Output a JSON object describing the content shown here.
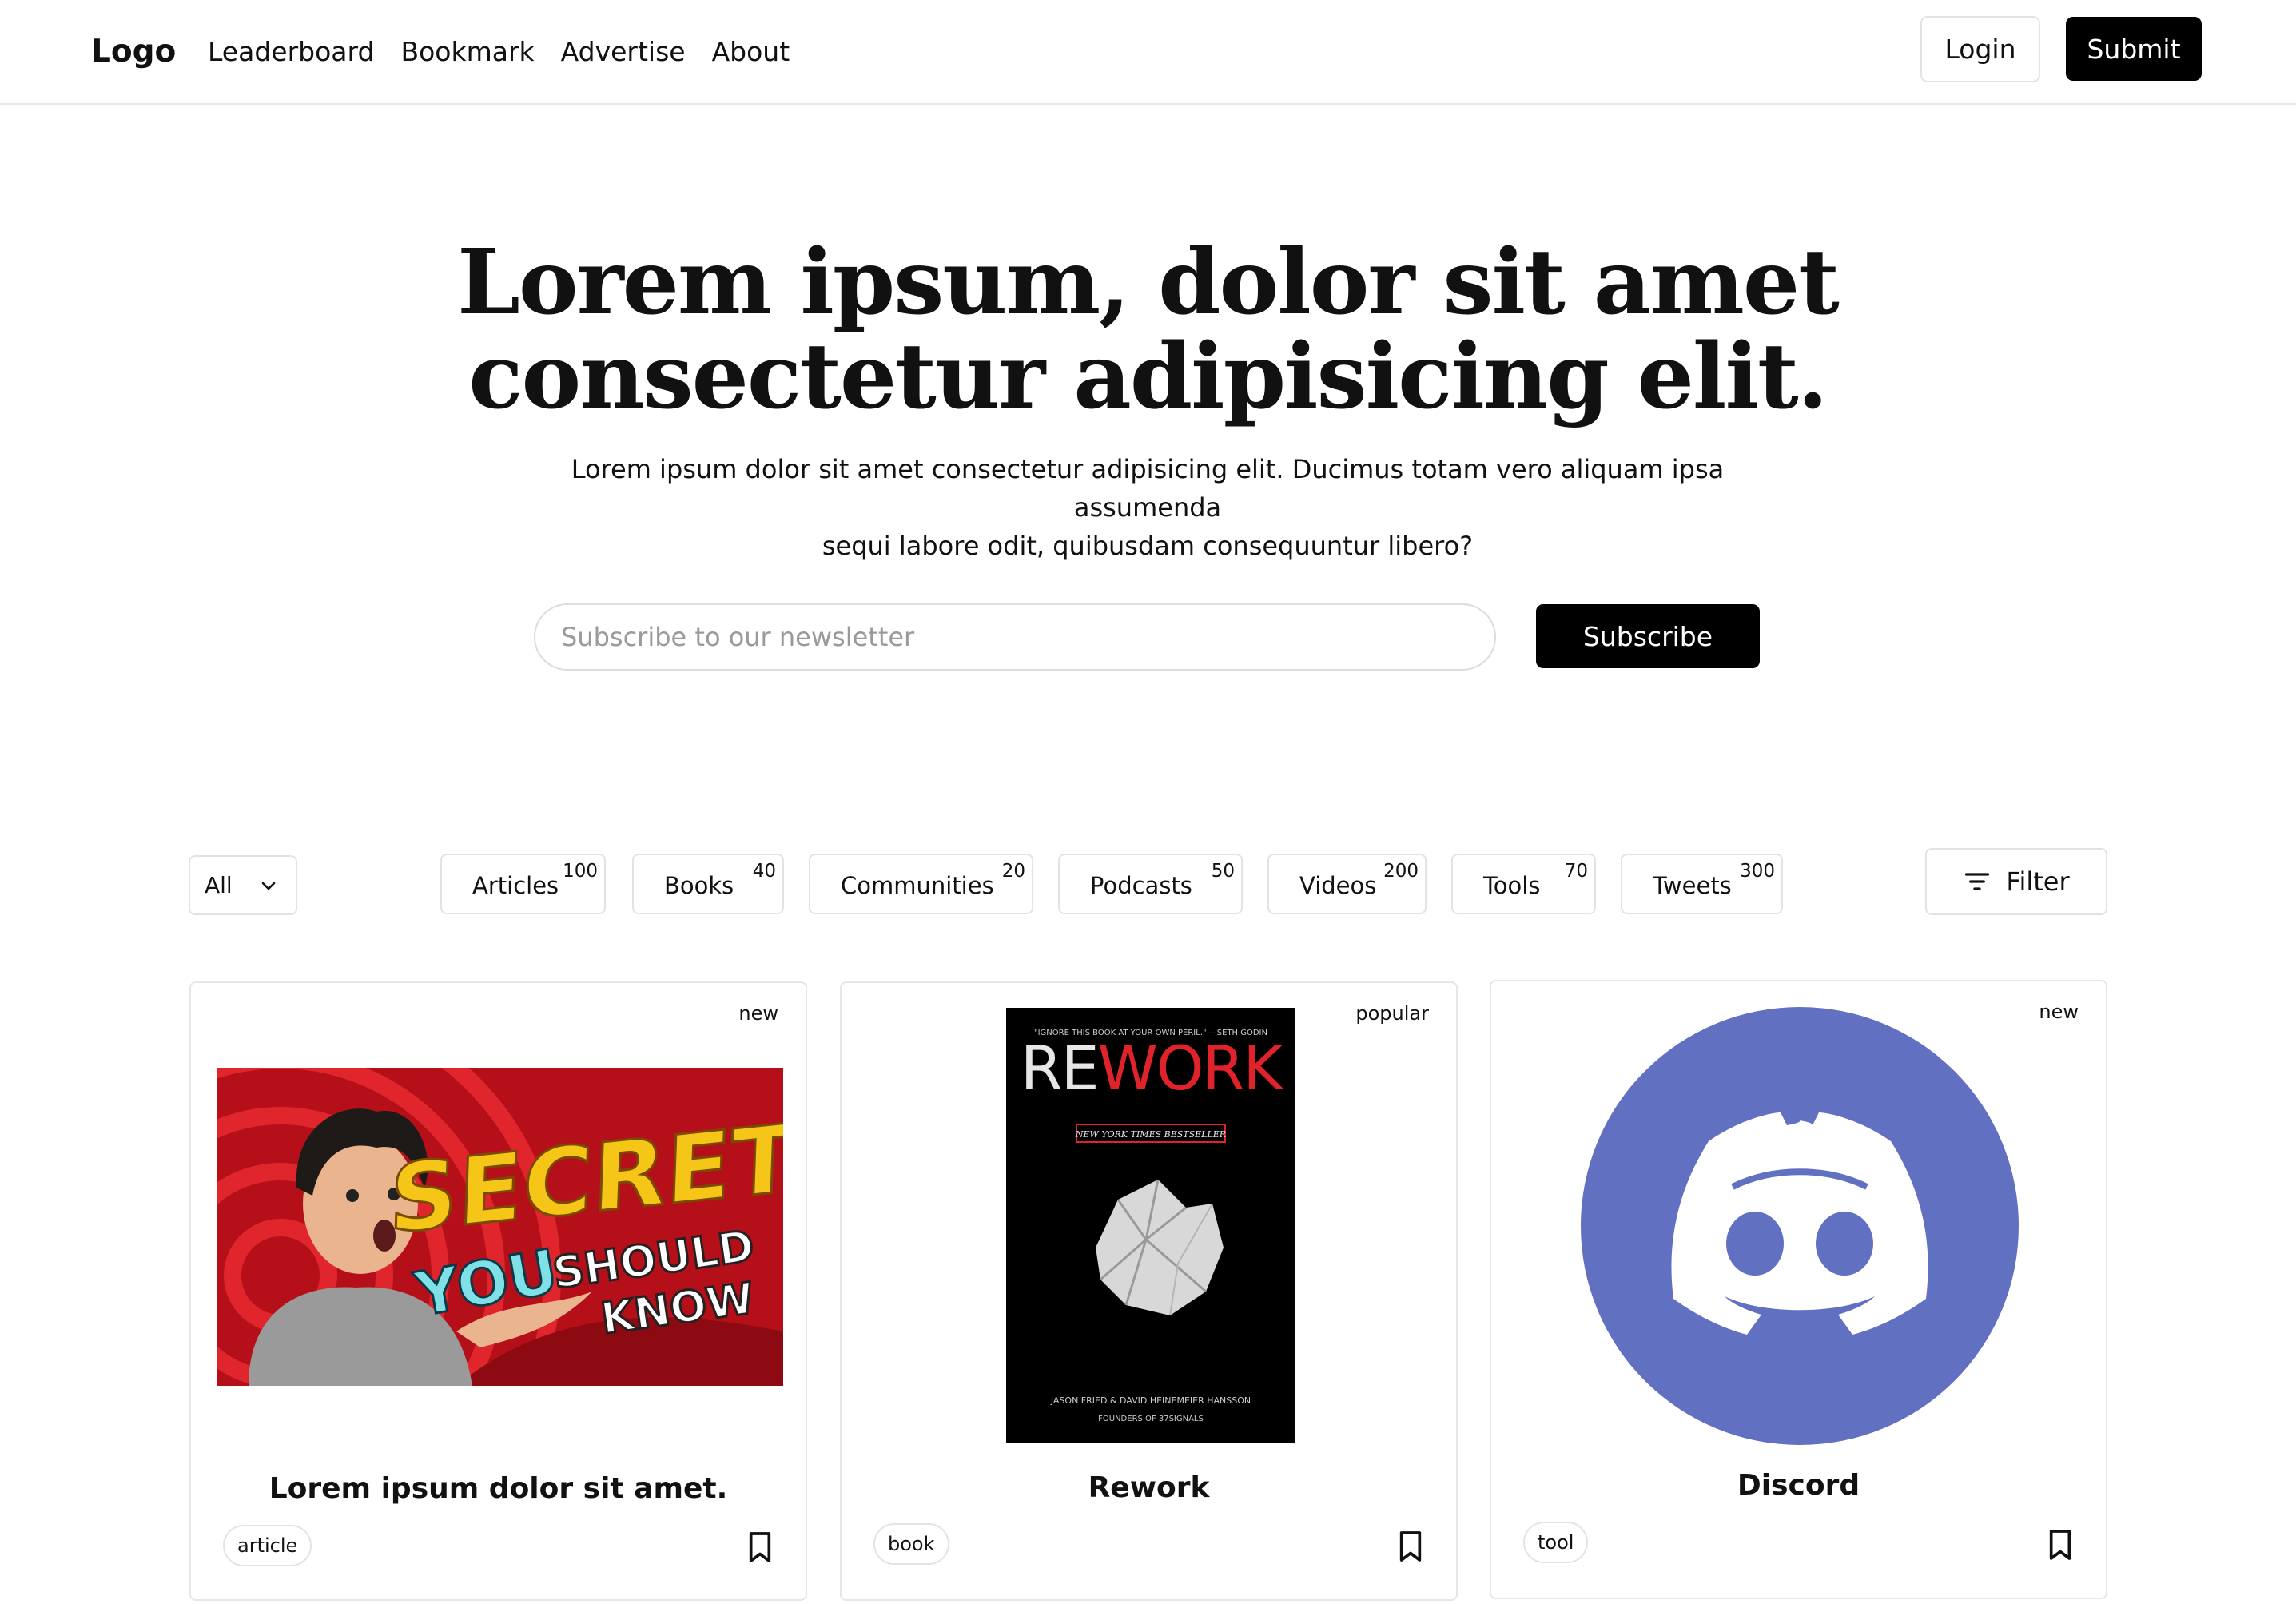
{
  "header": {
    "logo": "Logo",
    "nav": [
      "Leaderboard",
      "Bookmark",
      "Advertise",
      "About"
    ],
    "login_label": "Login",
    "submit_label": "Submit"
  },
  "hero": {
    "title_line1": "Lorem ipsum, dolor sit amet",
    "title_line2": "consectetur adipisicing elit.",
    "subtitle_line1": "Lorem ipsum dolor sit amet consectetur adipisicing elit. Ducimus totam vero aliquam ipsa assumenda",
    "subtitle_line2": "sequi labore odit, quibusdam consequuntur libero?"
  },
  "newsletter": {
    "placeholder": "Subscribe to our newsletter",
    "value": "",
    "button_label": "Subscribe"
  },
  "filters": {
    "select_value": "All",
    "categories": [
      {
        "label": "Articles",
        "count": "100"
      },
      {
        "label": "Books",
        "count": "40"
      },
      {
        "label": "Communities",
        "count": "20"
      },
      {
        "label": "Podcasts",
        "count": "50"
      },
      {
        "label": "Videos",
        "count": "200"
      },
      {
        "label": "Tools",
        "count": "70"
      },
      {
        "label": "Tweets",
        "count": "300"
      }
    ],
    "filter_label": "Filter"
  },
  "cards": [
    {
      "badge": "new",
      "title": "Lorem ipsum dolor sit amet.",
      "tag": "article",
      "image": {
        "word1": "SECRETS",
        "word2": "YOU",
        "word3": "SHOULD",
        "word4": "KNOW"
      }
    },
    {
      "badge": "popular",
      "title": "Rework",
      "tag": "book",
      "image": {
        "quote": "\"IGNORE THIS BOOK AT YOUR OWN PERIL.\" —SETH GODIN",
        "title_re": "RE",
        "title_work": "WORK",
        "bestseller": "NEW YORK TIMES BESTSELLER",
        "authors": "JASON FRIED & DAVID HEINEMEIER HANSSON",
        "founders": "FOUNDERS OF 37SIGNALS"
      }
    },
    {
      "badge": "new",
      "title": "Discord",
      "tag": "tool",
      "image": {
        "icon": "discord-logo"
      }
    }
  ],
  "colors": {
    "primary_button": "#000000",
    "discord_blurple": "#6170C0",
    "thumbnail_red": "#C8141A",
    "thumbnail_yellow": "#F5C518",
    "rework_red": "#E0232B"
  }
}
